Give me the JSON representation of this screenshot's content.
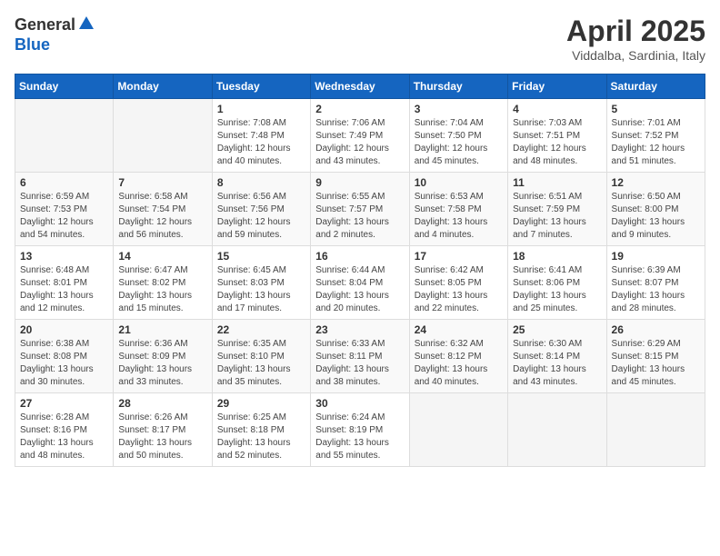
{
  "logo": {
    "general": "General",
    "blue": "Blue"
  },
  "title": {
    "month": "April 2025",
    "location": "Viddalba, Sardinia, Italy"
  },
  "weekdays": [
    "Sunday",
    "Monday",
    "Tuesday",
    "Wednesday",
    "Thursday",
    "Friday",
    "Saturday"
  ],
  "weeks": [
    [
      null,
      null,
      {
        "day": 1,
        "sunrise": "Sunrise: 7:08 AM",
        "sunset": "Sunset: 7:48 PM",
        "daylight": "Daylight: 12 hours and 40 minutes."
      },
      {
        "day": 2,
        "sunrise": "Sunrise: 7:06 AM",
        "sunset": "Sunset: 7:49 PM",
        "daylight": "Daylight: 12 hours and 43 minutes."
      },
      {
        "day": 3,
        "sunrise": "Sunrise: 7:04 AM",
        "sunset": "Sunset: 7:50 PM",
        "daylight": "Daylight: 12 hours and 45 minutes."
      },
      {
        "day": 4,
        "sunrise": "Sunrise: 7:03 AM",
        "sunset": "Sunset: 7:51 PM",
        "daylight": "Daylight: 12 hours and 48 minutes."
      },
      {
        "day": 5,
        "sunrise": "Sunrise: 7:01 AM",
        "sunset": "Sunset: 7:52 PM",
        "daylight": "Daylight: 12 hours and 51 minutes."
      }
    ],
    [
      {
        "day": 6,
        "sunrise": "Sunrise: 6:59 AM",
        "sunset": "Sunset: 7:53 PM",
        "daylight": "Daylight: 12 hours and 54 minutes."
      },
      {
        "day": 7,
        "sunrise": "Sunrise: 6:58 AM",
        "sunset": "Sunset: 7:54 PM",
        "daylight": "Daylight: 12 hours and 56 minutes."
      },
      {
        "day": 8,
        "sunrise": "Sunrise: 6:56 AM",
        "sunset": "Sunset: 7:56 PM",
        "daylight": "Daylight: 12 hours and 59 minutes."
      },
      {
        "day": 9,
        "sunrise": "Sunrise: 6:55 AM",
        "sunset": "Sunset: 7:57 PM",
        "daylight": "Daylight: 13 hours and 2 minutes."
      },
      {
        "day": 10,
        "sunrise": "Sunrise: 6:53 AM",
        "sunset": "Sunset: 7:58 PM",
        "daylight": "Daylight: 13 hours and 4 minutes."
      },
      {
        "day": 11,
        "sunrise": "Sunrise: 6:51 AM",
        "sunset": "Sunset: 7:59 PM",
        "daylight": "Daylight: 13 hours and 7 minutes."
      },
      {
        "day": 12,
        "sunrise": "Sunrise: 6:50 AM",
        "sunset": "Sunset: 8:00 PM",
        "daylight": "Daylight: 13 hours and 9 minutes."
      }
    ],
    [
      {
        "day": 13,
        "sunrise": "Sunrise: 6:48 AM",
        "sunset": "Sunset: 8:01 PM",
        "daylight": "Daylight: 13 hours and 12 minutes."
      },
      {
        "day": 14,
        "sunrise": "Sunrise: 6:47 AM",
        "sunset": "Sunset: 8:02 PM",
        "daylight": "Daylight: 13 hours and 15 minutes."
      },
      {
        "day": 15,
        "sunrise": "Sunrise: 6:45 AM",
        "sunset": "Sunset: 8:03 PM",
        "daylight": "Daylight: 13 hours and 17 minutes."
      },
      {
        "day": 16,
        "sunrise": "Sunrise: 6:44 AM",
        "sunset": "Sunset: 8:04 PM",
        "daylight": "Daylight: 13 hours and 20 minutes."
      },
      {
        "day": 17,
        "sunrise": "Sunrise: 6:42 AM",
        "sunset": "Sunset: 8:05 PM",
        "daylight": "Daylight: 13 hours and 22 minutes."
      },
      {
        "day": 18,
        "sunrise": "Sunrise: 6:41 AM",
        "sunset": "Sunset: 8:06 PM",
        "daylight": "Daylight: 13 hours and 25 minutes."
      },
      {
        "day": 19,
        "sunrise": "Sunrise: 6:39 AM",
        "sunset": "Sunset: 8:07 PM",
        "daylight": "Daylight: 13 hours and 28 minutes."
      }
    ],
    [
      {
        "day": 20,
        "sunrise": "Sunrise: 6:38 AM",
        "sunset": "Sunset: 8:08 PM",
        "daylight": "Daylight: 13 hours and 30 minutes."
      },
      {
        "day": 21,
        "sunrise": "Sunrise: 6:36 AM",
        "sunset": "Sunset: 8:09 PM",
        "daylight": "Daylight: 13 hours and 33 minutes."
      },
      {
        "day": 22,
        "sunrise": "Sunrise: 6:35 AM",
        "sunset": "Sunset: 8:10 PM",
        "daylight": "Daylight: 13 hours and 35 minutes."
      },
      {
        "day": 23,
        "sunrise": "Sunrise: 6:33 AM",
        "sunset": "Sunset: 8:11 PM",
        "daylight": "Daylight: 13 hours and 38 minutes."
      },
      {
        "day": 24,
        "sunrise": "Sunrise: 6:32 AM",
        "sunset": "Sunset: 8:12 PM",
        "daylight": "Daylight: 13 hours and 40 minutes."
      },
      {
        "day": 25,
        "sunrise": "Sunrise: 6:30 AM",
        "sunset": "Sunset: 8:14 PM",
        "daylight": "Daylight: 13 hours and 43 minutes."
      },
      {
        "day": 26,
        "sunrise": "Sunrise: 6:29 AM",
        "sunset": "Sunset: 8:15 PM",
        "daylight": "Daylight: 13 hours and 45 minutes."
      }
    ],
    [
      {
        "day": 27,
        "sunrise": "Sunrise: 6:28 AM",
        "sunset": "Sunset: 8:16 PM",
        "daylight": "Daylight: 13 hours and 48 minutes."
      },
      {
        "day": 28,
        "sunrise": "Sunrise: 6:26 AM",
        "sunset": "Sunset: 8:17 PM",
        "daylight": "Daylight: 13 hours and 50 minutes."
      },
      {
        "day": 29,
        "sunrise": "Sunrise: 6:25 AM",
        "sunset": "Sunset: 8:18 PM",
        "daylight": "Daylight: 13 hours and 52 minutes."
      },
      {
        "day": 30,
        "sunrise": "Sunrise: 6:24 AM",
        "sunset": "Sunset: 8:19 PM",
        "daylight": "Daylight: 13 hours and 55 minutes."
      },
      null,
      null,
      null
    ]
  ]
}
